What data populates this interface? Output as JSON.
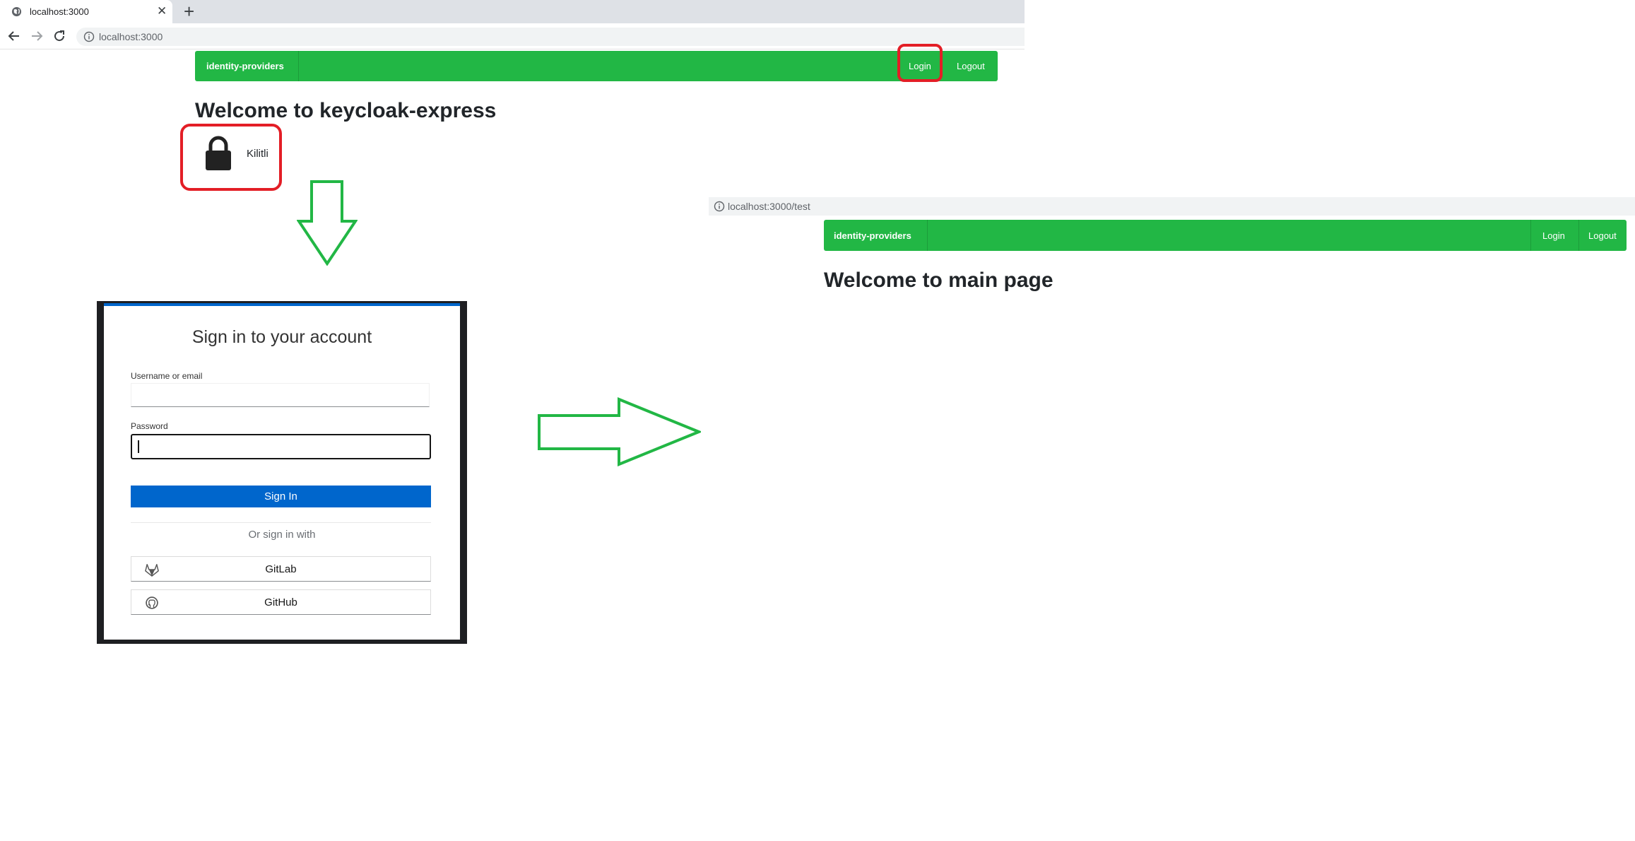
{
  "browser": {
    "tab_title": "localhost:3000",
    "tab_close": "✕",
    "new_tab": "+",
    "url": "localhost:3000"
  },
  "page1": {
    "brand": "identity-providers",
    "login": "Login",
    "logout": "Logout",
    "heading": "Welcome to keycloak-express",
    "lock_label": "Kilitli"
  },
  "keycloak": {
    "title": "Sign in to your account",
    "username_label": "Username or email",
    "username_value": "",
    "password_label": "Password",
    "password_value": "",
    "sign_in": "Sign In",
    "or_sign_in_with": "Or sign in with",
    "providers": [
      {
        "label": "GitLab",
        "icon": "gitlab-icon"
      },
      {
        "label": "GitHub",
        "icon": "github-icon"
      }
    ]
  },
  "page2": {
    "url": "localhost:3000/test",
    "brand": "identity-providers",
    "login": "Login",
    "logout": "Logout",
    "heading": "Welcome to main page"
  },
  "colors": {
    "navbar": "#22b745",
    "highlight": "#e31e26",
    "arrow": "#22b745",
    "sign_in_button": "#0066cc"
  }
}
